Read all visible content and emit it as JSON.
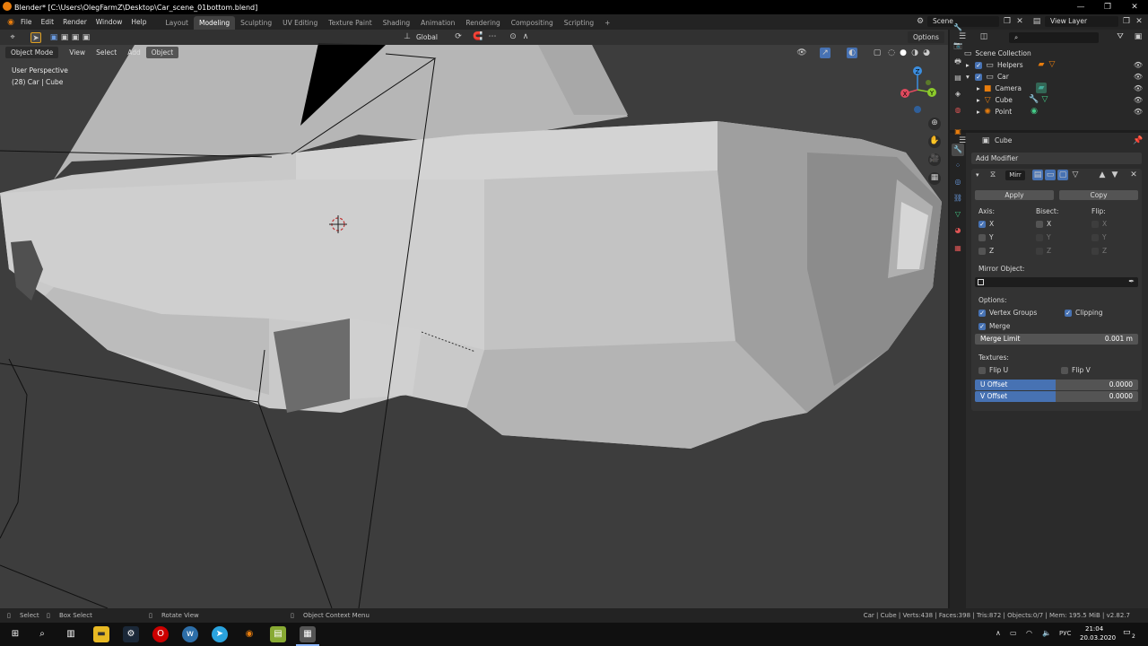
{
  "window": {
    "title": "Blender* [C:\\Users\\OlegFarmZ\\Desktop\\Car_scene_01bottom.blend]",
    "minimize": "—",
    "maximize": "❐",
    "close": "✕"
  },
  "menu": [
    "File",
    "Edit",
    "Render",
    "Window",
    "Help"
  ],
  "workspaces": [
    "Layout",
    "Modeling",
    "Sculpting",
    "UV Editing",
    "Texture Paint",
    "Shading",
    "Animation",
    "Rendering",
    "Compositing",
    "Scripting"
  ],
  "active_workspace": "Modeling",
  "add_workspace": "+",
  "scene_field": "Scene",
  "view_layer_field": "View Layer",
  "viewport": {
    "transform_orientation": "Global",
    "options_label": "Options",
    "mode": "Object Mode",
    "menu": [
      "View",
      "Select",
      "Add",
      "Object"
    ],
    "overlay_line1": "User Perspective",
    "overlay_line2": "(28) Car | Cube",
    "gizmo_axes": {
      "x": "X",
      "y": "Y",
      "z": "Z"
    }
  },
  "outliner": {
    "search_placeholder": "",
    "root": "Scene Collection",
    "items": [
      {
        "label": "Helpers"
      },
      {
        "label": "Car"
      },
      {
        "label": "Camera"
      },
      {
        "label": "Cube"
      },
      {
        "label": "Point"
      }
    ]
  },
  "properties": {
    "object_name": "Cube",
    "add_modifier": "Add Modifier",
    "modifier_name": "Mirr",
    "apply": "Apply",
    "copy": "Copy",
    "axis_label": "Axis:",
    "bisect_label": "Bisect:",
    "flip_label": "Flip:",
    "axes": [
      "X",
      "Y",
      "Z"
    ],
    "mirror_object_label": "Mirror Object:",
    "options_label": "Options:",
    "vertex_groups": "Vertex Groups",
    "clipping": "Clipping",
    "merge": "Merge",
    "merge_limit_label": "Merge Limit",
    "merge_limit_value": "0.001 m",
    "textures_label": "Textures:",
    "flip_u": "Flip U",
    "flip_v": "Flip V",
    "u_offset_label": "U Offset",
    "u_offset_value": "0.0000",
    "v_offset_label": "V Offset",
    "v_offset_value": "0.0000"
  },
  "statusbar": {
    "select": "Select",
    "box_select": "Box Select",
    "rotate_view": "Rotate View",
    "context_menu": "Object Context Menu",
    "stats": "Car | Cube | Verts:438 | Faces:398 | Tris:872 | Objects:0/7 | Mem: 195.5 MiB | v2.82.7"
  },
  "taskbar": {
    "time": "21:04",
    "date": "20.03.2020",
    "lang": "РУС",
    "notifications": "2"
  },
  "colors": {
    "accent": "#4772b3",
    "active_tab": "#424242",
    "viewport_bg": "#3d3d3d",
    "axis_x": "#e04a5e",
    "axis_y": "#8ccb2c",
    "axis_z": "#3b8ee0"
  }
}
